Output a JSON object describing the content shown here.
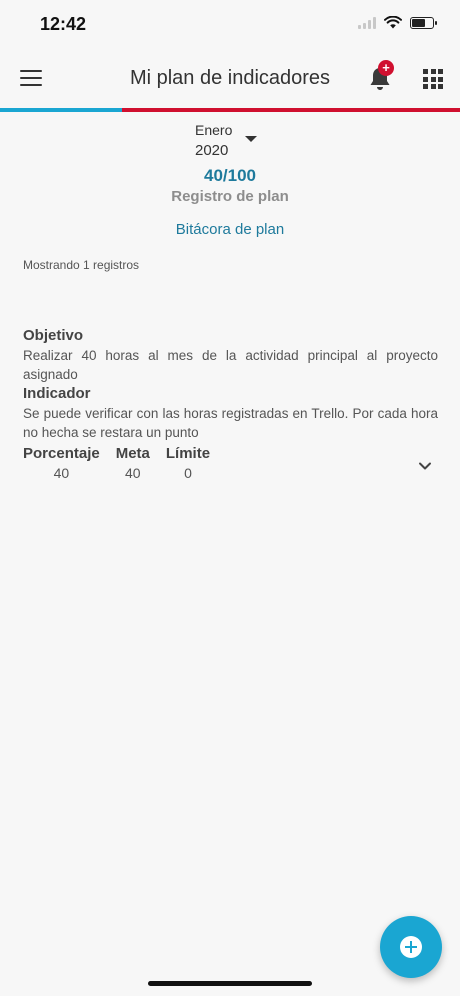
{
  "status_bar": {
    "time": "12:42"
  },
  "header": {
    "title": "Mi plan de indicadores",
    "notification_badge": "+",
    "icons": {
      "menu": "hamburger-menu-icon",
      "notifications": "bell-icon",
      "apps": "grid-apps-icon"
    }
  },
  "colors": {
    "accent_blue": "#1aa6d2",
    "accent_red": "#d0102f",
    "link": "#1e7a9c"
  },
  "period": {
    "month": "Enero",
    "year": "2020"
  },
  "summary": {
    "score": "40/100",
    "plan_label": "Registro de plan",
    "bitacora_link": "Bitácora de plan",
    "showing_text": "Mostrando 1 registros"
  },
  "record": {
    "objective_label": "Objetivo",
    "objective_text": "Realizar 40 horas al mes de la actividad principal al proyecto asignado",
    "indicator_label": "Indicador",
    "indicator_text": "Se puede verificar con las horas registradas en Trello. Por cada hora no hecha se restara un punto",
    "metrics": [
      {
        "label": "Porcentaje",
        "value": "40"
      },
      {
        "label": "Meta",
        "value": "40"
      },
      {
        "label": "Límite",
        "value": "0"
      }
    ]
  },
  "fab": {
    "icon": "add-circle-icon"
  }
}
